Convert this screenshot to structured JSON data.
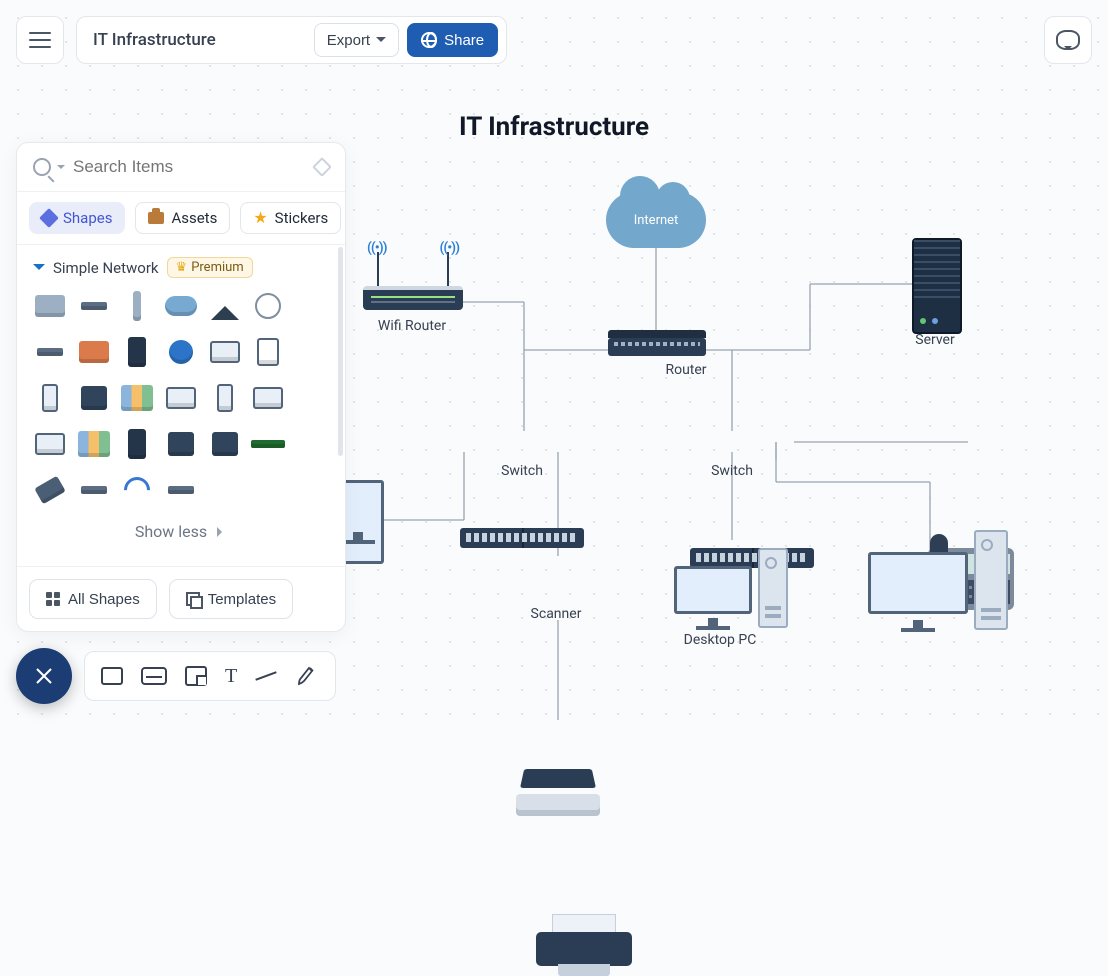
{
  "header": {
    "title": "IT Infrastructure",
    "export_label": "Export",
    "share_label": "Share"
  },
  "panel": {
    "search_placeholder": "Search Items",
    "tabs": {
      "shapes": "Shapes",
      "assets": "Assets",
      "stickers": "Stickers"
    },
    "section": {
      "title": "Simple Network",
      "badge": "Premium"
    },
    "show_less": "Show less",
    "footer": {
      "all_shapes": "All Shapes",
      "templates": "Templates"
    }
  },
  "diagram": {
    "title": "IT Infrastructure",
    "internet": "Internet",
    "wifi_router": "Wifi Router",
    "router": "Router",
    "server": "Server",
    "switch": "Switch",
    "scanner": "Scanner",
    "desktop_pc": "Desktop PC"
  }
}
